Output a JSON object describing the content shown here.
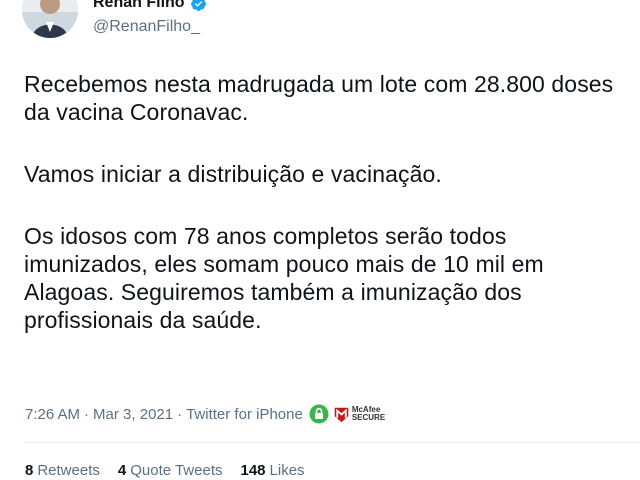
{
  "author": {
    "display_name": "Renan Filho",
    "handle": "@RenanFilho_"
  },
  "tweet": {
    "paragraphs": [
      "Recebemos nesta madrugada um lote com 28.800 doses da vacina Coronavac.",
      "Vamos iniciar a distribuição e vacinação.",
      "Os idosos com 78 anos completos serão todos imunizados, eles somam pouco mais de 10 mil em Alagoas. Seguiremos também a imunização dos profissionais da saúde."
    ]
  },
  "meta": {
    "time": "7:26 AM",
    "date": "Mar 3, 2021",
    "source": "Twitter for iPhone",
    "separator": "·",
    "badge_line1": "McAfee",
    "badge_line2": "SECURE"
  },
  "stats": {
    "retweets_count": "8",
    "retweets_label": "Retweets",
    "quote_count": "4",
    "quote_label": "Quote Tweets",
    "likes_count": "148",
    "likes_label": "Likes"
  },
  "colors": {
    "text": "#0f1419",
    "secondary": "#5b7083",
    "verified_blue": "#1da1f2",
    "lock_green": "#3bb54a",
    "mcafee_red": "#c01818"
  }
}
